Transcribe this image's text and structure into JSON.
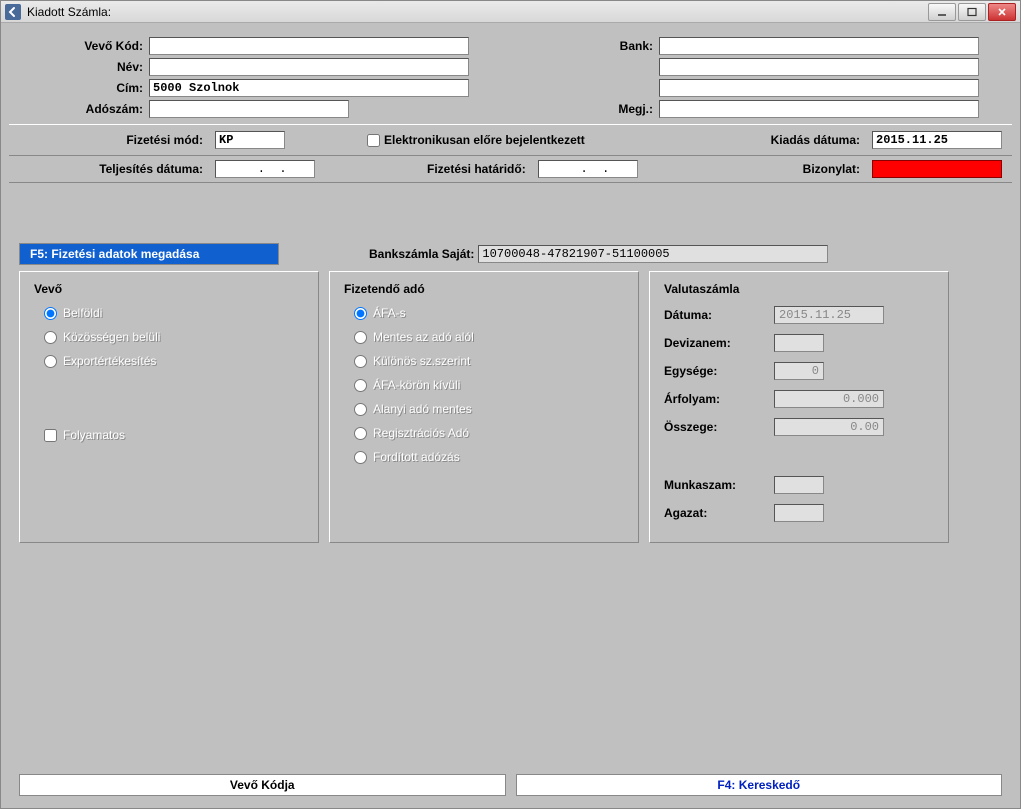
{
  "window": {
    "title": "Kiadott Számla:"
  },
  "top": {
    "vevo_kod_label": "Vevő  Kód:",
    "vevo_kod": "",
    "bank_label": "Bank:",
    "bank": "",
    "nev_label": "Név:",
    "nev": "",
    "bank2": "",
    "cim_label": "Cím:",
    "cim": "5000 Szolnok",
    "bank3": "",
    "adoszam_label": "Adószám:",
    "adoszam": "",
    "megj_label": "Megj.:",
    "megj": ""
  },
  "mid": {
    "fizetesi_mod_label": "Fizetési mód:",
    "fizetesi_mod": "KP",
    "elektronikus_label": "Elektronikusan előre bejelentkezett",
    "kiadas_datuma_label": "Kiadás dátuma:",
    "kiadas_datuma": "2015.11.25",
    "teljesites_label": "Teljesítés dátuma:",
    "teljesites": "  .  .",
    "fizetesi_hatarido_label": "Fizetési határidő:",
    "fizetesi_hatarido": "  .  .",
    "bizonylat_label": "Bizonylat:"
  },
  "tab": {
    "title": "F5: Fizetési adatok megadása",
    "bank_sajat_label": "Bankszámla Saját:",
    "bank_sajat": "10700048-47821907-51100005"
  },
  "vevo": {
    "title": "Vevő",
    "r1": "Belföldi",
    "r2": "Közösségen belüli",
    "r3": "Exportértékesítés",
    "folyamatos": "Folyamatos"
  },
  "ado": {
    "title": "Fizetendő adó",
    "r1": "ÁFA-s",
    "r2": "Mentes az adó alól",
    "r3": "Különös sz.szerint",
    "r4": "ÁFA-körön kívüli",
    "r5": "Alanyi adó mentes",
    "r6": "Regisztrációs Adó",
    "r7": "Fordított adózás"
  },
  "valuta": {
    "title": "Valutaszámla",
    "datuma_label": "Dátuma:",
    "datuma": "2015.11.25",
    "devizanem_label": "Devizanem:",
    "devizanem": "",
    "egysege_label": "Egysége:",
    "egysege": "0",
    "arfolyam_label": "Árfolyam:",
    "arfolyam": "0.000",
    "osszege_label": "Összege:",
    "osszege": "0.00",
    "munkaszam_label": "Munkaszam:",
    "munkaszam": "",
    "agazat_label": "Agazat:",
    "agazat": ""
  },
  "footer": {
    "left": "Vevő Kódja",
    "right": "F4: Kereskedő"
  }
}
